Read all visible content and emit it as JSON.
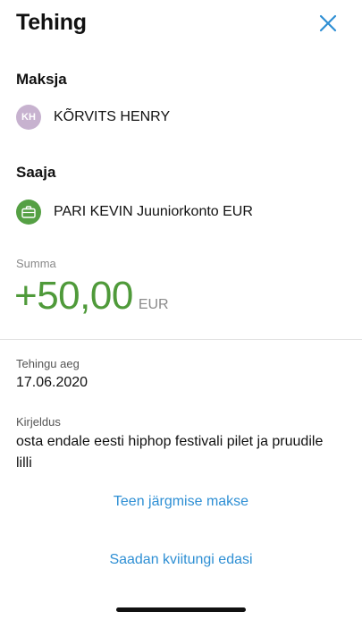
{
  "header": {
    "title": "Tehing",
    "close_icon": "close-icon"
  },
  "payer": {
    "label": "Maksja",
    "initials": "KH",
    "name": "KÕRVITS HENRY"
  },
  "payee": {
    "label": "Saaja",
    "icon": "briefcase-icon",
    "name": "PARI KEVIN Juuniorkonto EUR"
  },
  "amount": {
    "label": "Summa",
    "value": "+50,00",
    "currency": "EUR",
    "color": "#4f9a3a"
  },
  "transaction_time": {
    "label": "Tehingu aeg",
    "value": "17.06.2020"
  },
  "description": {
    "label": "Kirjeldus",
    "value": "osta endale eesti hiphop festivali pilet ja pruudile lilli"
  },
  "actions": {
    "next_payment": "Teen järgmise makse",
    "forward_receipt": "Saadan kviitungi edasi",
    "link_color": "#2e8fd4"
  }
}
